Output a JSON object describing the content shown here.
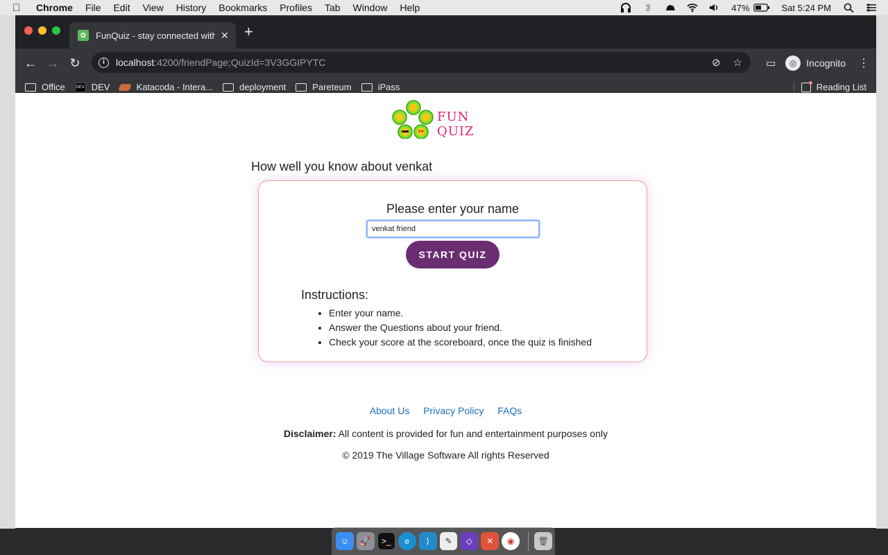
{
  "menubar": {
    "app_name": "Chrome",
    "items": [
      "File",
      "Edit",
      "View",
      "History",
      "Bookmarks",
      "Profiles",
      "Tab",
      "Window",
      "Help"
    ],
    "battery": "47%",
    "clock": "Sat 5:24 PM"
  },
  "browser": {
    "tab_title": "FunQuiz - stay connected with",
    "url_host": "localhost",
    "url_path": ":4200/friendPage;QuizId=3V3GGIPYTC",
    "profile_label": "Incognito",
    "bookmarks": [
      {
        "label": "Office",
        "icon": "folder-icon"
      },
      {
        "label": "DEV",
        "icon": "dev-icon"
      },
      {
        "label": "Katacoda - Intera...",
        "icon": "katacoda-icon"
      },
      {
        "label": "deployment",
        "icon": "folder-icon"
      },
      {
        "label": "Pareteum",
        "icon": "folder-icon"
      },
      {
        "label": "iPass",
        "icon": "folder-icon"
      }
    ],
    "reading_list": "Reading List"
  },
  "page": {
    "logo_text": "FUN QUIZ",
    "heading": "How well you know about venkat",
    "prompt": "Please enter your name",
    "name_value": "venkat friend",
    "start_button": "START QUIZ",
    "instructions_title": "Instructions:",
    "instructions": [
      "Enter your name.",
      "Answer the Questions about your friend.",
      "Check your score at the scoreboard, once the quiz is finished"
    ],
    "footer_links": [
      "About Us",
      "Privacy Policy",
      "FAQs"
    ],
    "disclaimer_label": "Disclaimer:",
    "disclaimer_text": " All content is provided for fun and entertainment purposes only",
    "copyright": "© 2019 The Village Software All rights Reserved"
  },
  "colors": {
    "brand_pink": "#e0246f",
    "button_purple": "#6a2d72",
    "card_border": "#f29b9b",
    "link_blue": "#1a6fc0",
    "emoji_green": "#7be52c"
  }
}
